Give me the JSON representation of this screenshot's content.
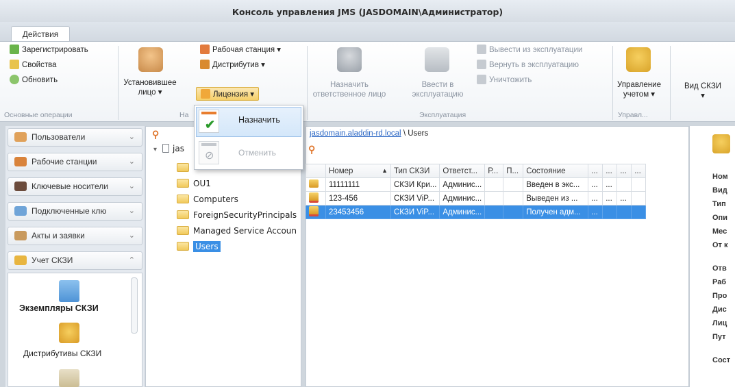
{
  "window": {
    "title": "Консоль управления JMS (JASDOMAIN\\Администратор)"
  },
  "tabs": [
    {
      "label": "Действия"
    }
  ],
  "ribbon": {
    "basic": {
      "register": "Зарегистрировать",
      "properties": "Свойства",
      "refresh": "Обновить",
      "group": "Основные операции"
    },
    "install": {
      "installer_line1": "Установившее",
      "installer_line2": "лицо ▾",
      "workstation": "Рабочая станция ▾",
      "distributive": "Дистрибутив ▾",
      "license": "Лицензия ▾",
      "group": "На"
    },
    "exploit": {
      "assign_line1": "Назначить",
      "assign_line2": "ответственное лицо",
      "enter_line1": "Ввести в",
      "enter_line2": "эксплуатацию",
      "withdraw": "Вывести из эксплуатации",
      "return": "Вернуть в эксплуатацию",
      "destroy": "Уничтожить",
      "group": "Эксплуатация"
    },
    "account": {
      "line1": "Управление",
      "line2": "учетом ▾",
      "group": "Управл..."
    },
    "view": {
      "label": "Вид СКЗИ",
      "arrow": "▾"
    }
  },
  "license_menu": {
    "items": [
      {
        "label": "Назначить",
        "enabled": true
      },
      {
        "label": "Отменить",
        "enabled": false
      }
    ]
  },
  "nav": {
    "items": [
      {
        "label": "Пользователи",
        "chevron": "⌄"
      },
      {
        "label": "Рабочие станции",
        "chevron": "⌄"
      },
      {
        "label": "Ключевые носители",
        "chevron": "⌄"
      },
      {
        "label": "Подключенные клю",
        "chevron": "⌄"
      },
      {
        "label": "Акты и заявки",
        "chevron": "⌄"
      },
      {
        "label": "Учет СКЗИ",
        "chevron": "⌃"
      }
    ],
    "panel": [
      {
        "label": "Экземпляры СКЗИ"
      },
      {
        "label": "Дистрибутивы СКЗИ"
      }
    ]
  },
  "tree": {
    "root": "jas",
    "items": [
      {
        "label": "OU1"
      },
      {
        "label": "Computers"
      },
      {
        "label": "ForeignSecurityPrincipals"
      },
      {
        "label": "Managed Service Accoun"
      },
      {
        "label": "Users"
      }
    ]
  },
  "breadcrumb": {
    "domain": "jasdomain.aladdin-rd.local",
    "sep": "\\",
    "current": "Users"
  },
  "grid": {
    "columns": [
      "Номер",
      "Тип СКЗИ",
      "Ответст...",
      "Р...",
      "П...",
      "Состояние",
      "...",
      "...",
      "...",
      "..."
    ],
    "sort_arrow": "▲",
    "rows": [
      {
        "number": "11111111",
        "type": "СКЗИ Кри...",
        "resp": "Админис...",
        "state": "Введен в экс...",
        "extra": [
          "...",
          "..."
        ]
      },
      {
        "number": "123-456",
        "type": "СКЗИ ViP...",
        "resp": "Админис...",
        "state": "Выведен из ...",
        "extra": [
          "...",
          "...",
          "..."
        ]
      },
      {
        "number": "23453456",
        "type": "СКЗИ ViP...",
        "resp": "Админис...",
        "state": "Получен адм...",
        "extra": [
          "..."
        ]
      }
    ]
  },
  "details": {
    "fields": [
      "Ном",
      "Вид",
      "Тип",
      "Опи",
      "Мес",
      "От к",
      "Отв",
      "Раб",
      "Про",
      "Дис",
      "Лиц",
      "Пут",
      "Сост"
    ]
  }
}
